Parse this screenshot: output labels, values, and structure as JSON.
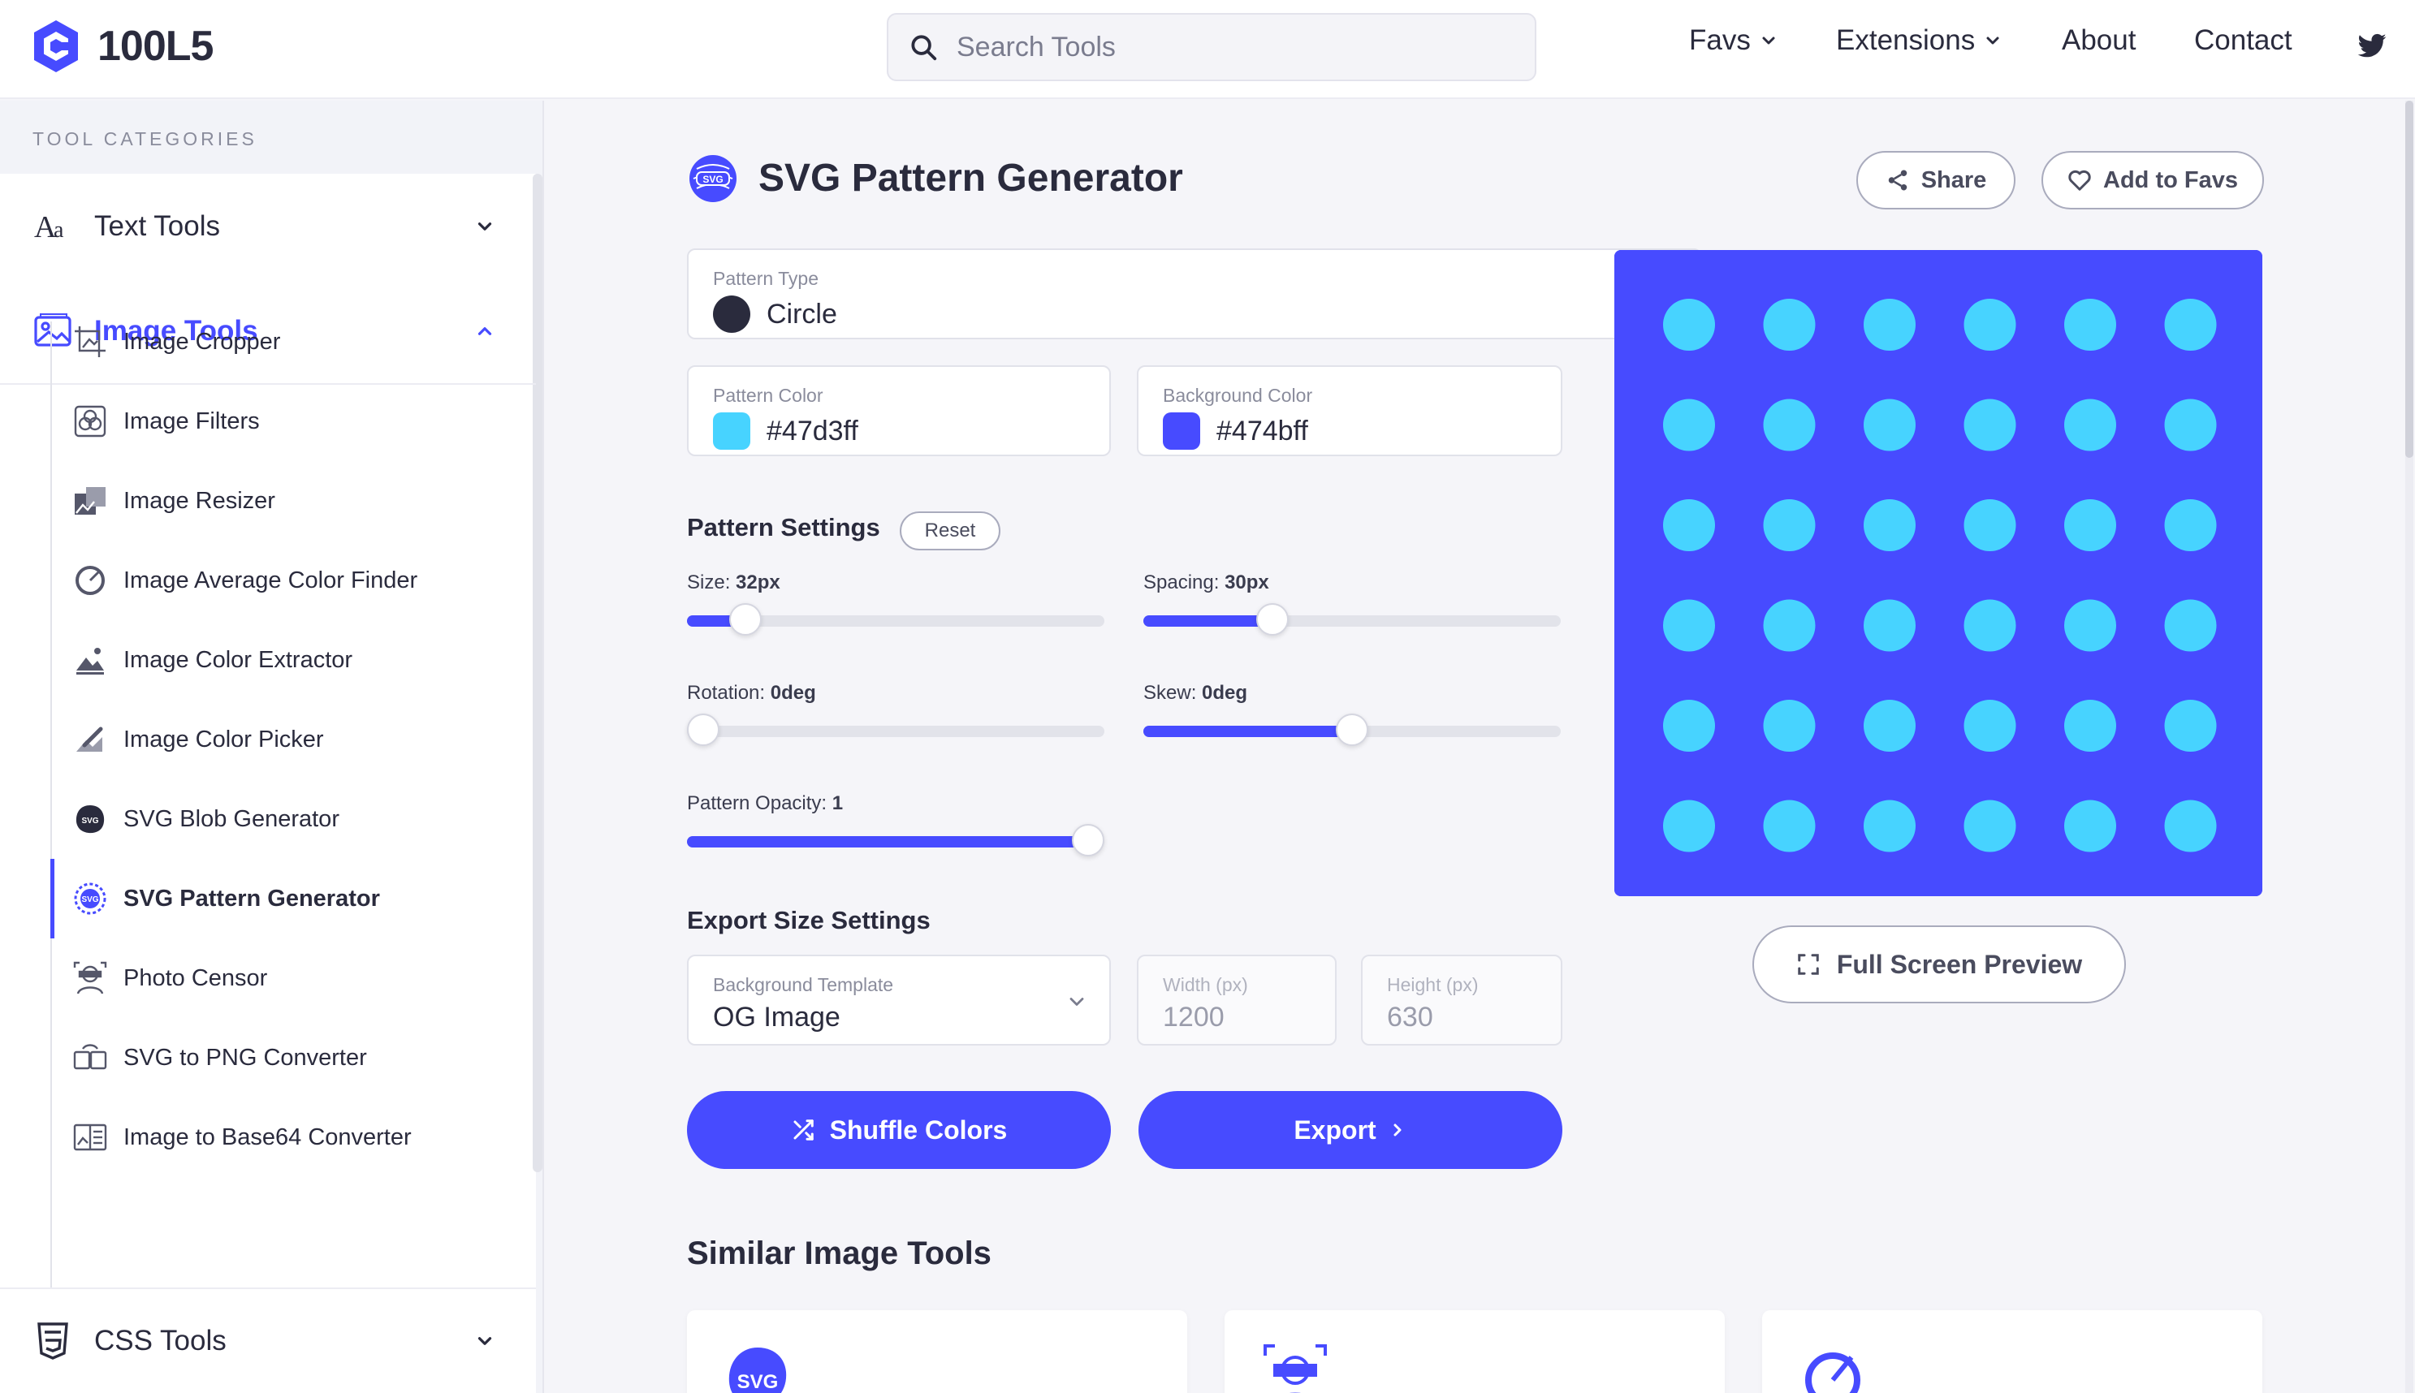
{
  "brand": {
    "name": "100L5",
    "accent": "#474bff"
  },
  "search": {
    "placeholder": "Search Tools"
  },
  "nav": [
    {
      "label": "Favs",
      "has_dropdown": true
    },
    {
      "label": "Extensions",
      "has_dropdown": true
    },
    {
      "label": "About",
      "has_dropdown": false
    },
    {
      "label": "Contact",
      "has_dropdown": false
    },
    {
      "label": "",
      "icon": "twitter-icon"
    }
  ],
  "sidebar": {
    "heading": "TOOL CATEGORIES",
    "categories": [
      {
        "label": "Text Tools",
        "icon": "text-icon",
        "expanded": false
      },
      {
        "label": "Image Tools",
        "icon": "image-icon",
        "expanded": true
      },
      {
        "label": "CSS Tools",
        "icon": "css-icon",
        "expanded": false
      }
    ],
    "image_tools": [
      {
        "label": "Image Cropper",
        "icon": "crop-icon"
      },
      {
        "label": "Image Filters",
        "icon": "filters-icon"
      },
      {
        "label": "Image Resizer",
        "icon": "resize-icon"
      },
      {
        "label": "Image Average Color Finder",
        "icon": "color-finder-icon"
      },
      {
        "label": "Image Color Extractor",
        "icon": "color-extractor-icon"
      },
      {
        "label": "Image Color Picker",
        "icon": "color-picker-icon"
      },
      {
        "label": "SVG Blob Generator",
        "icon": "svg-blob-icon"
      },
      {
        "label": "SVG Pattern Generator",
        "icon": "svg-pattern-icon",
        "active": true
      },
      {
        "label": "Photo Censor",
        "icon": "photo-censor-icon"
      },
      {
        "label": "SVG to PNG Converter",
        "icon": "svg-to-png-icon"
      },
      {
        "label": "Image to Base64 Converter",
        "icon": "base64-icon"
      }
    ]
  },
  "main": {
    "title": "SVG Pattern Generator",
    "share_label": "Share",
    "favs_label": "Add to Favs",
    "pattern_type": {
      "label": "Pattern Type",
      "value": "Circle"
    },
    "pattern_color": {
      "label": "Pattern Color",
      "value": "#47d3ff"
    },
    "background_color": {
      "label": "Background Color",
      "value": "#474bff"
    },
    "pattern_settings": {
      "title": "Pattern Settings",
      "reset_label": "Reset",
      "size": {
        "label": "Size:",
        "value": "32px",
        "level": 0.14
      },
      "spacing": {
        "label": "Spacing:",
        "value": "30px",
        "level": 0.31
      },
      "rotation": {
        "label": "Rotation:",
        "value": "0deg",
        "level": 0.0
      },
      "skew": {
        "label": "Skew:",
        "value": "0deg",
        "level": 0.5
      },
      "opacity": {
        "label": "Pattern Opacity:",
        "value": "1",
        "level": 1.0
      }
    },
    "export_settings": {
      "title": "Export Size Settings",
      "template": {
        "label": "Background Template",
        "value": "OG Image"
      },
      "width": {
        "label": "Width (px)",
        "value": "1200"
      },
      "height": {
        "label": "Height (px)",
        "value": "630"
      }
    },
    "shuffle_label": "Shuffle Colors",
    "export_label": "Export",
    "full_screen_label": "Full Screen Preview",
    "similar_title": "Similar Image Tools",
    "similar_cards": [
      {
        "icon": "svg-blob-icon"
      },
      {
        "icon": "photo-censor-icon"
      },
      {
        "icon": "color-finder-icon"
      }
    ]
  }
}
